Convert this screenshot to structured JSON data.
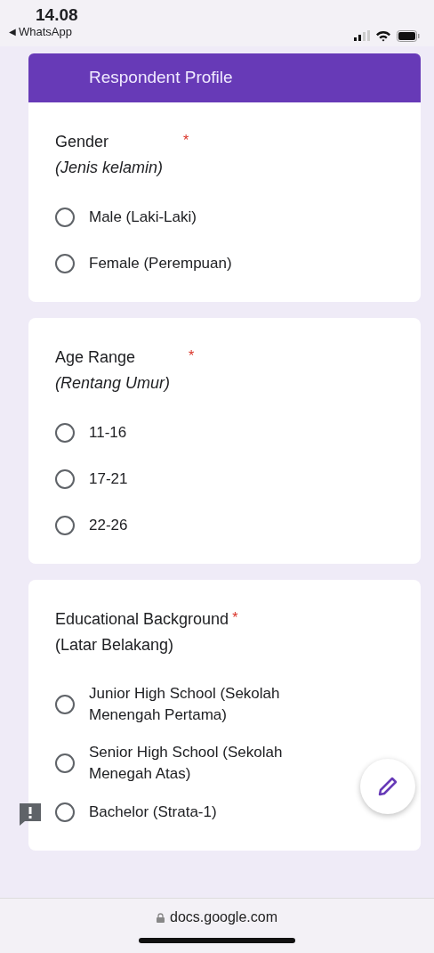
{
  "status_bar": {
    "time": "14.08",
    "back_arrow": "◀",
    "back_app": "WhatsApp"
  },
  "section_header": {
    "title": "Respondent Profile"
  },
  "questions": [
    {
      "title": "Gender",
      "required_mark": "*",
      "subtitle": "(Jenis kelamin)",
      "subtitle_italic": true,
      "options": [
        {
          "label": "Male (Laki-Laki)",
          "selected": false
        },
        {
          "label": "Female (Perempuan)",
          "selected": false
        }
      ]
    },
    {
      "title": "Age Range",
      "required_mark": "*",
      "subtitle": "(Rentang Umur)",
      "subtitle_italic": true,
      "options": [
        {
          "label": "11-16",
          "selected": false
        },
        {
          "label": "17-21",
          "selected": false
        },
        {
          "label": "22-26",
          "selected": false
        }
      ]
    },
    {
      "title": "Educational Background",
      "required_mark": "*",
      "subtitle": "(Latar Belakang)",
      "subtitle_italic": false,
      "options": [
        {
          "label": "Junior High School (Sekolah Menengah Pertama)",
          "selected": false
        },
        {
          "label": "Senior High School (Sekolah Menegah Atas)",
          "selected": false
        },
        {
          "label": "Bachelor (Strata-1)",
          "selected": false
        }
      ]
    }
  ],
  "address_bar": {
    "url": "docs.google.com"
  }
}
